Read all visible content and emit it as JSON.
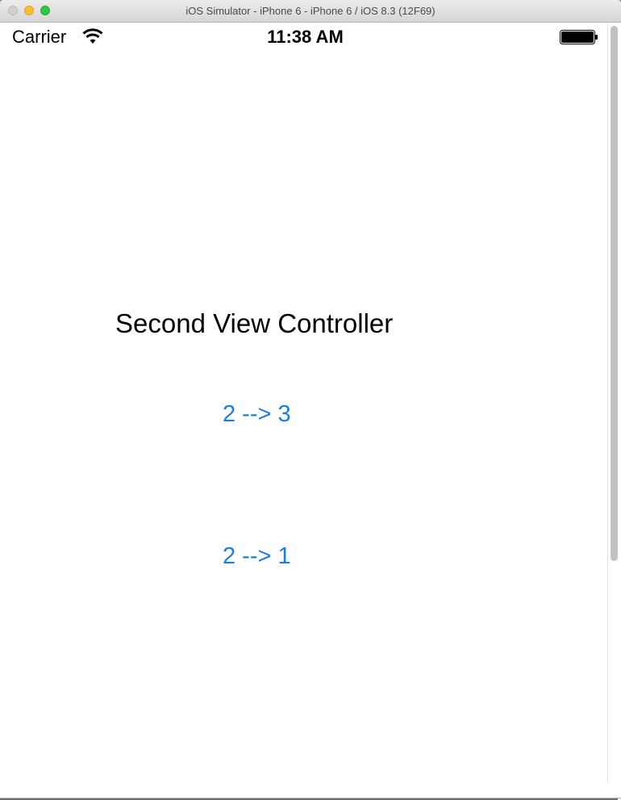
{
  "window": {
    "title": "iOS Simulator - iPhone 6 - iPhone 6 / iOS 8.3 (12F69)"
  },
  "status_bar": {
    "carrier": "Carrier",
    "time": "11:38 AM",
    "wifi_icon": "wifi-icon",
    "battery_icon": "battery-icon"
  },
  "content": {
    "title": "Second View Controller",
    "button_to_3": "2 --> 3",
    "button_to_1": "2 --> 1"
  },
  "colors": {
    "button_tint": "#1a7ee6",
    "text": "#000000",
    "background": "#ffffff"
  }
}
